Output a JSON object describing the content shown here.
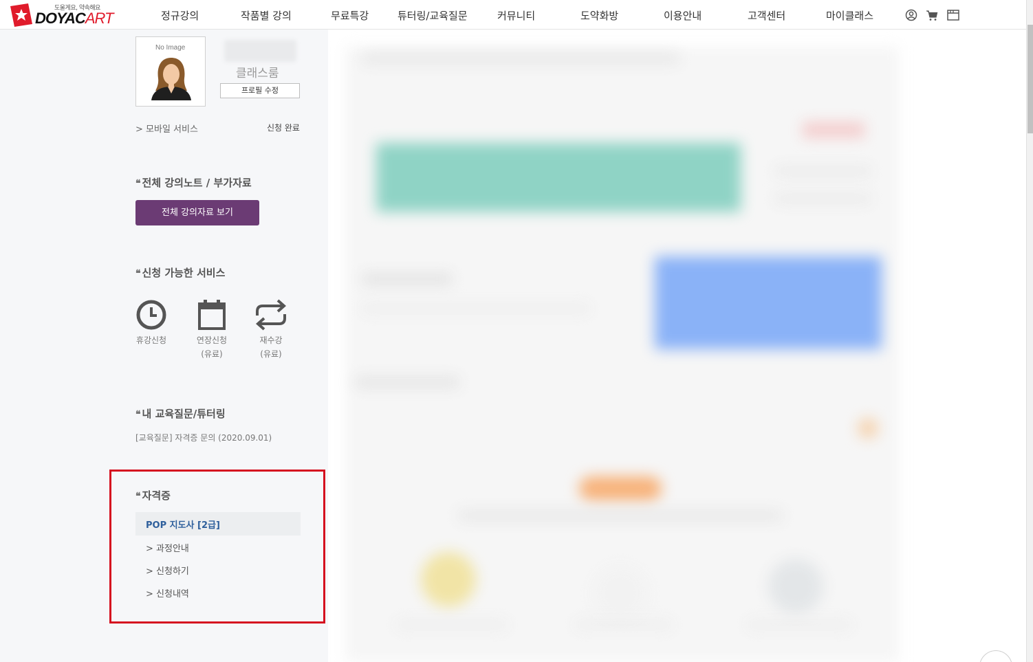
{
  "header": {
    "logo_tagline": "도울게요, 약속해요",
    "logo_text_1": "DOYAC",
    "logo_text_2": "ART",
    "nav": [
      {
        "label": "정규강의"
      },
      {
        "label": "작품별 강의"
      },
      {
        "label": "무료특강"
      },
      {
        "label": "튜터링/교육질문"
      },
      {
        "label": "커뮤니티"
      },
      {
        "label": "도약화방"
      },
      {
        "label": "이용안내"
      },
      {
        "label": "고객센터"
      },
      {
        "label": "마이클래스"
      }
    ],
    "icons": [
      "user-icon",
      "cart-icon",
      "window-icon"
    ]
  },
  "profile": {
    "no_image_text": "No Image",
    "classroom_label": "클래스룸",
    "edit_button": "프로필 수정",
    "mobile_service_label": "> 모바일 서비스",
    "mobile_service_status": "신청 완료"
  },
  "lecture_notes": {
    "title": "전체 강의노트 / 부가자료",
    "button": "전체 강의자료 보기"
  },
  "services": {
    "title": "신청 가능한 서비스",
    "items": [
      {
        "line1": "휴강신청",
        "line2": "",
        "icon": "clock-icon"
      },
      {
        "line1": "연장신청",
        "line2": "(유료)",
        "icon": "calendar-icon"
      },
      {
        "line1": "재수강",
        "line2": "(유료)",
        "icon": "repeat-icon"
      }
    ]
  },
  "my_questions": {
    "title": "내 교육질문/튜터링",
    "items": [
      {
        "text": "[교육질문] 자격증 문의 (2020.09.01)"
      }
    ]
  },
  "certificate": {
    "title": "자격증",
    "name": "POP 지도사 [2급]",
    "links": [
      {
        "label": "> 과정안내"
      },
      {
        "label": "> 신청하기"
      },
      {
        "label": "> 신청내역"
      }
    ]
  },
  "colors": {
    "accent_purple": "#6b3b74",
    "highlight_red": "#d50f1f",
    "brand_red": "#e01b2b",
    "cert_blue": "#2e5f9c"
  }
}
